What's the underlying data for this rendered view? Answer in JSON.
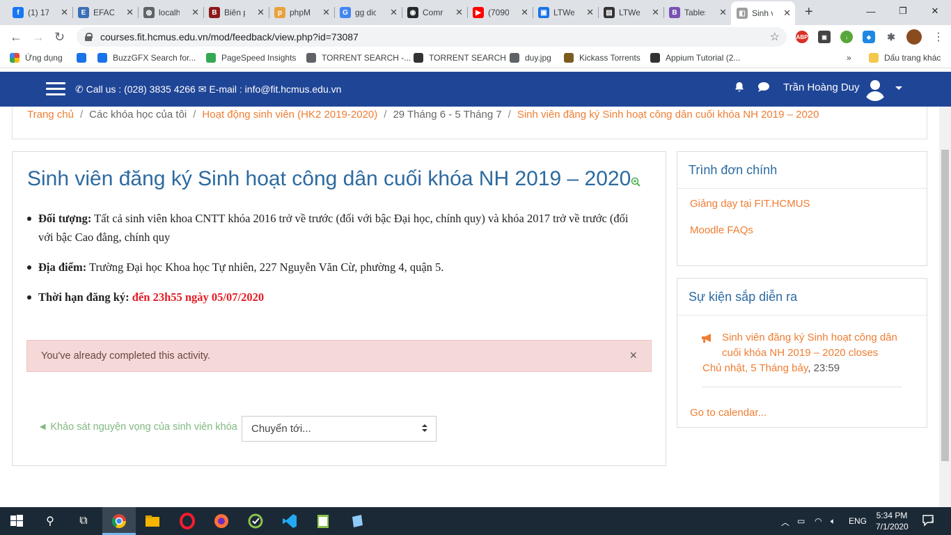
{
  "browser": {
    "tabs": [
      {
        "label": "(1) 17",
        "color": "#1877f2",
        "glyph": "f"
      },
      {
        "label": "EFAC",
        "color": "#3b6fb6",
        "glyph": "E"
      },
      {
        "label": "localh",
        "color": "#5f6368",
        "glyph": "◍"
      },
      {
        "label": "Biên p",
        "color": "#8b1a1a",
        "glyph": "B"
      },
      {
        "label": "phpM",
        "color": "#e8a33d",
        "glyph": "p"
      },
      {
        "label": "gg dic",
        "color": "#4285f4",
        "glyph": "G"
      },
      {
        "label": "Comr",
        "color": "#24292e",
        "glyph": "◉"
      },
      {
        "label": "(7090",
        "color": "#ff0000",
        "glyph": "▶"
      },
      {
        "label": "LTWe",
        "color": "#1a73e8",
        "glyph": "▣"
      },
      {
        "label": "LTWe",
        "color": "#333333",
        "glyph": "▤"
      },
      {
        "label": "Tables",
        "color": "#7952b3",
        "glyph": "B"
      },
      {
        "label": "Sinh v",
        "color": "#9e9e9e",
        "glyph": "◧",
        "active": true
      }
    ],
    "url": "courses.fit.hcmus.edu.vn/mod/feedback/view.php?id=73087",
    "bookmarks": [
      {
        "label": "Ứng dụng",
        "color": "#ea4335"
      },
      {
        "label": "",
        "color": "#1a73e8"
      },
      {
        "label": "BuzzGFX Search for...",
        "color": "#1a73e8"
      },
      {
        "label": "PageSpeed Insights",
        "color": "#34a853"
      },
      {
        "label": "TORRENT SEARCH -...",
        "color": "#5f6368"
      },
      {
        "label": "TORRENT SEARCH",
        "color": "#333333"
      },
      {
        "label": "duy.jpg",
        "color": "#5f6368"
      },
      {
        "label": "Kickass Torrents",
        "color": "#7a5c1e"
      },
      {
        "label": "Appium Tutorial (2...",
        "color": "#333333"
      }
    ],
    "other_bookmarks": "Dấu trang khác",
    "overflow": "»"
  },
  "navbar": {
    "contact": "Call us : (028) 3835 4266 ✉ E-mail : info@fit.hcmus.edu.vn",
    "phone_icon": "phone-icon",
    "username": "Trần Hoàng Duy"
  },
  "breadcrumb": {
    "items": [
      {
        "label": "Trang chủ",
        "link": true
      },
      {
        "label": "Các khóa học của tôi",
        "link": false
      },
      {
        "label": "Hoạt động sinh viên (HK2 2019-2020)",
        "link": true
      },
      {
        "label": "29 Tháng 6 - 5 Tháng 7",
        "link": false
      },
      {
        "label": "Sinh viên đăng ký Sinh hoạt công dân cuối khóa NH 2019 – 2020",
        "link": true
      }
    ]
  },
  "main": {
    "title": "Sinh viên đăng ký Sinh hoạt công dân cuối khóa NH 2019 – 2020",
    "items": [
      {
        "label": "Đối tượng:",
        "text": " Tất cả sinh viên khoa CNTT khóa 2016 trở về trước (đối với bậc Đại học, chính quy) và khóa 2017 trở về trước (đối với bậc Cao đẳng, chính quy"
      },
      {
        "label": "Địa điểm:",
        "text": " Trường Đại học Khoa học Tự nhiên, 227 Nguyễn Văn Cừ, phường 4, quận 5."
      },
      {
        "label": "Thời hạn đăng ký:",
        "highlight": " đến 23h55 ngày 05/07/2020"
      }
    ],
    "alert": "You've already completed this activity.",
    "alert_close": "×",
    "prev_link": "◄ Khảo sát nguyện vọng của sinh viên khóa",
    "jump_to": "Chuyển tới..."
  },
  "sidebar": {
    "main_menu": {
      "title": "Trình đơn chính",
      "items": [
        "Giảng dạy tại FIT.HCMUS",
        "Moodle FAQs"
      ]
    },
    "upcoming": {
      "title": "Sự kiện sắp diễn ra",
      "event_name": "Sinh viên đăng ký Sinh hoạt công dân cuối khóa NH 2019 – 2020 closes",
      "event_date": "Chủ nhật, 5 Tháng bảy",
      "event_time": ", 23:59",
      "calendar_link": "Go to calendar..."
    }
  },
  "taskbar": {
    "language": "ENG",
    "time": "5:34 PM",
    "date": "7/1/2020"
  },
  "colors": {
    "navbar": "#1f4596",
    "link": "#ef7d33",
    "title": "#2c6aa0",
    "deadline": "#e51c23",
    "alert_bg": "#f5d8d8"
  }
}
